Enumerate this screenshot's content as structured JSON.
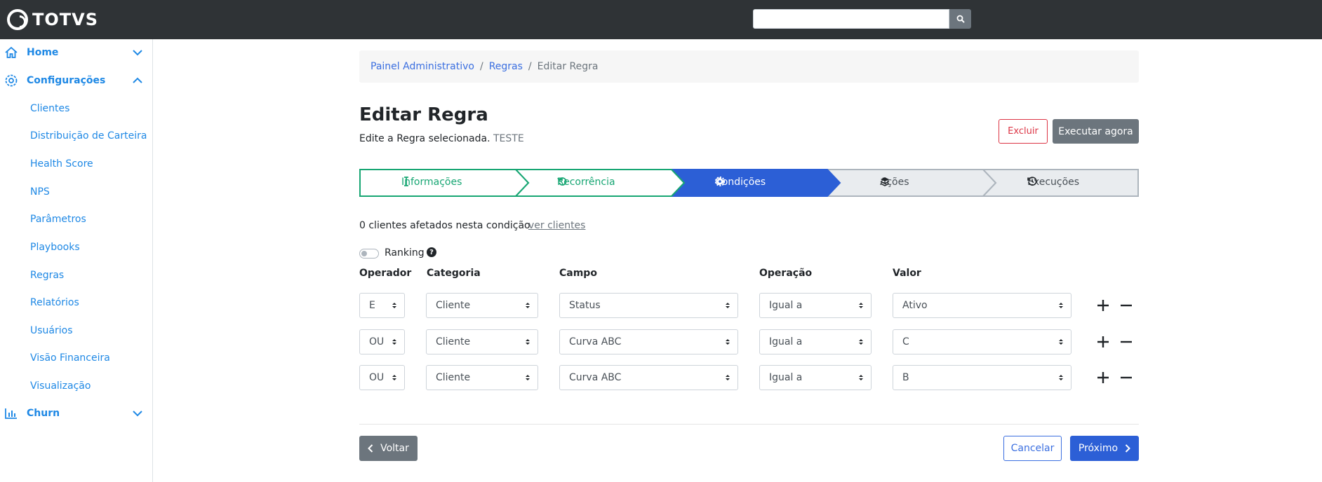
{
  "topbar": {
    "logo_text": "TOTVS",
    "search_placeholder": ""
  },
  "sidebar": {
    "groups": {
      "home": {
        "label": "Home"
      },
      "config": {
        "label": "Configurações"
      },
      "churn": {
        "label": "Churn"
      }
    },
    "items": [
      "Clientes",
      "Distribuição de Carteira",
      "Health Score",
      "NPS",
      "Parâmetros",
      "Playbooks",
      "Regras",
      "Relatórios",
      "Usuários",
      "Visão Financeira",
      "Visualização"
    ]
  },
  "breadcrumb": {
    "items": [
      "Painel Administrativo",
      "Regras"
    ],
    "current": "Editar Regra"
  },
  "header": {
    "title": "Editar Regra",
    "subtitle": "Edite a Regra selecionada.",
    "rule_name": "TESTE",
    "delete_label": "Excluir",
    "execute_label": "Executar agora"
  },
  "steps": [
    {
      "label": "Informações",
      "state": "done"
    },
    {
      "label": "Recorrência",
      "state": "done"
    },
    {
      "label": "Condições",
      "state": "active"
    },
    {
      "label": "Ações",
      "state": "pending"
    },
    {
      "label": "Execuções",
      "state": "pending"
    }
  ],
  "conditions": {
    "affected_text": "0 clientes afetados nesta condição",
    "view_clients_label": "ver clientes",
    "ranking_label": "Ranking",
    "ranking_enabled": false,
    "headers": {
      "operator": "Operador",
      "category": "Categoria",
      "field": "Campo",
      "operation": "Operação",
      "value": "Valor"
    },
    "rows": [
      {
        "operator": "E",
        "category": "Cliente",
        "field": "Status",
        "operation": "Igual a",
        "value": "Ativo"
      },
      {
        "operator": "OU",
        "category": "Cliente",
        "field": "Curva ABC",
        "operation": "Igual a",
        "value": "C"
      },
      {
        "operator": "OU",
        "category": "Cliente",
        "field": "Curva ABC",
        "operation": "Igual a",
        "value": "B"
      }
    ]
  },
  "footer": {
    "back_label": "Voltar",
    "cancel_label": "Cancelar",
    "next_label": "Próximo"
  },
  "colors": {
    "primary": "#2c5fd6",
    "success": "#17a673",
    "danger": "#dc3545",
    "secondary": "#6c757d",
    "link": "#1e88e5"
  }
}
